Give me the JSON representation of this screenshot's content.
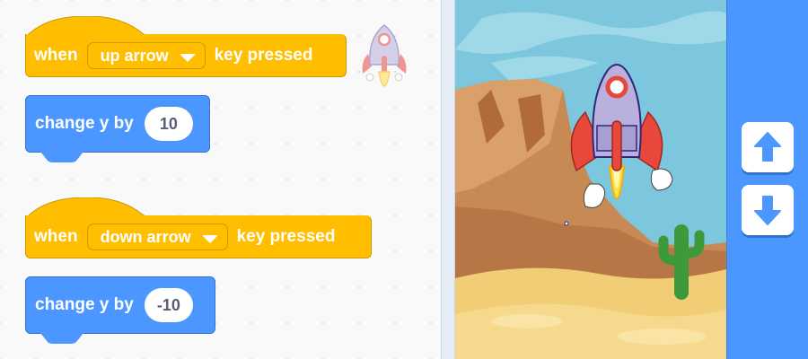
{
  "scripts": [
    {
      "hat_when": "when",
      "key": "up arrow",
      "hat_pressed": "key pressed",
      "motion_label": "change y by",
      "motion_value": "10"
    },
    {
      "hat_when": "when",
      "key": "down arrow",
      "hat_pressed": "key pressed",
      "motion_label": "change y by",
      "motion_value": "-10"
    }
  ],
  "colors": {
    "events_block": "#ffbf00",
    "motion_block": "#4c97ff",
    "sidebar": "#4c97ff"
  },
  "stage": {
    "sprite": "rocketship",
    "backdrop": "desert"
  },
  "sidebar": {
    "buttons": [
      "up-arrow-icon",
      "down-arrow-icon"
    ]
  }
}
